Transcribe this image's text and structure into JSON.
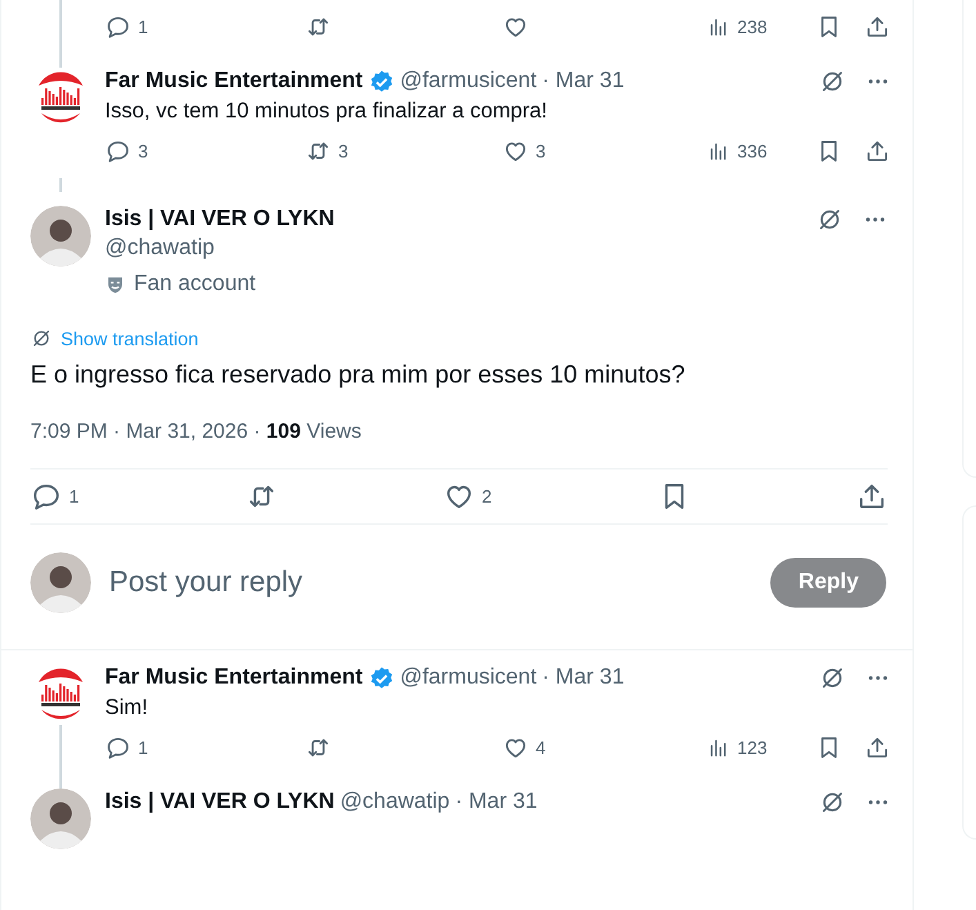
{
  "thread": [
    {
      "kind": "actions_only",
      "connected_above": true,
      "actions": {
        "replies": "1",
        "views": "238"
      }
    },
    {
      "kind": "reply",
      "connected_above": true,
      "connected_below": false,
      "author": {
        "name": "Far Music Entertainment",
        "verified": true,
        "handle": "@farmusicent",
        "date": "· Mar 31",
        "avatar": {
          "kind": "logo"
        }
      },
      "text": "Isso, vc tem 10 minutos pra finalizar a compra!",
      "actions": {
        "replies": "3",
        "reposts": "3",
        "likes": "3",
        "views": "336"
      }
    },
    {
      "kind": "focus",
      "connected_above": true,
      "author": {
        "name": "Isis | VAI VER O LYKN",
        "verified": false,
        "handle": "@chawatip",
        "label": "Fan account",
        "avatar": {
          "kind": "person"
        }
      },
      "translate": "Show translation",
      "text": "E o ingresso fica reservado pra mim por esses 10 minutos?",
      "meta": "7:09 PM · Mar 31, 2026 ·",
      "views_count": "109",
      "views_label": "Views",
      "actions": {
        "replies": "1",
        "likes": "2"
      }
    },
    {
      "kind": "composer",
      "avatar": {
        "kind": "person"
      },
      "placeholder": "Post your reply",
      "button": "Reply",
      "button_disabled": true
    },
    {
      "kind": "reply",
      "connected_above": false,
      "connected_below": true,
      "author": {
        "name": "Far Music Entertainment",
        "verified": true,
        "handle": "@farmusicent",
        "date": "· Mar 31",
        "avatar": {
          "kind": "logo"
        }
      },
      "text": "Sim!",
      "actions": {
        "replies": "1",
        "likes": "4",
        "views": "123"
      }
    },
    {
      "kind": "reply",
      "connected_above": true,
      "connected_below": false,
      "author": {
        "name": "Isis | VAI VER O LYKN",
        "verified": false,
        "handle": "@chawatip",
        "date": "· Mar 31",
        "avatar": {
          "kind": "person"
        }
      }
    }
  ]
}
